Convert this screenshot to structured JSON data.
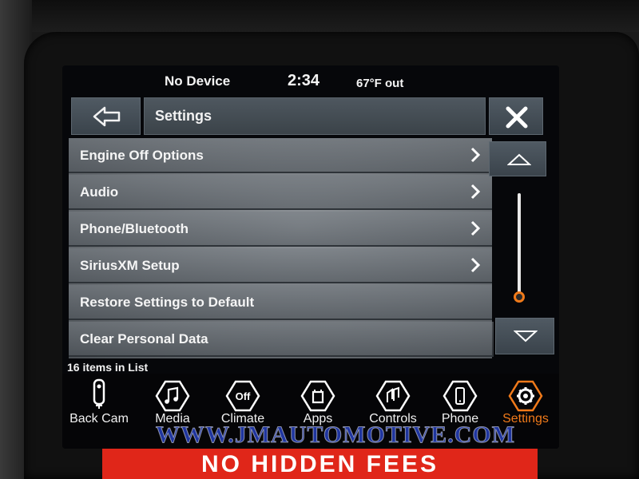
{
  "status_bar": {
    "device": "No Device",
    "time": "2:34",
    "temperature": "67°F out"
  },
  "header": {
    "title": "Settings",
    "back_icon": "back-arrow-icon",
    "close_icon": "close-icon"
  },
  "settings_list": {
    "items": [
      {
        "label": "Engine Off Options",
        "has_arrow": true
      },
      {
        "label": "Audio",
        "has_arrow": true
      },
      {
        "label": "Phone/Bluetooth",
        "has_arrow": true
      },
      {
        "label": "SiriusXM Setup",
        "has_arrow": true
      },
      {
        "label": "Restore Settings to Default",
        "has_arrow": false
      },
      {
        "label": "Clear Personal Data",
        "has_arrow": false
      }
    ],
    "count_text": "16 items in List",
    "scroll_position": 0
  },
  "dock": {
    "items": [
      {
        "label": "Back Cam",
        "icon": "back-camera-icon",
        "active": false
      },
      {
        "label": "Media",
        "icon": "media-note-icon",
        "active": false
      },
      {
        "label": "Climate",
        "icon": "climate-off-icon",
        "icon_text": "Off",
        "active": false
      },
      {
        "label": "Apps",
        "icon": "apps-icon",
        "active": false
      },
      {
        "label": "Controls",
        "icon": "controls-icon",
        "active": false
      },
      {
        "label": "Phone",
        "icon": "phone-icon",
        "active": false
      },
      {
        "label": "Settings",
        "icon": "settings-gear-icon",
        "active": true
      }
    ]
  },
  "overlay": {
    "watermark": "WWW.JMAUTOMOTIVE.COM",
    "banner": "NO HIDDEN FEES"
  },
  "colors": {
    "accent": "#f07a1a",
    "banner": "#e02619",
    "watermark": "#2846d2"
  }
}
